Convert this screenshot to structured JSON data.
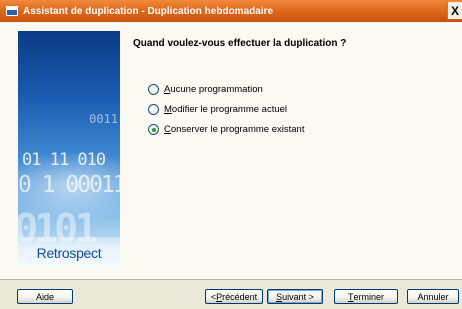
{
  "window": {
    "title": "Assistant de duplication - Duplication hebdomadaire",
    "close_label": "X"
  },
  "side_panel": {
    "brand": "Retrospect",
    "decor_digits": [
      "0011",
      "01 11 010",
      "0 1 00011",
      "0101"
    ]
  },
  "main": {
    "question": "Quand voulez-vous effectuer la duplication ?",
    "options": [
      {
        "accel": "A",
        "rest": "ucune programmation",
        "selected": false
      },
      {
        "accel": "M",
        "rest": "odifier le programme actuel",
        "selected": false
      },
      {
        "accel": "C",
        "rest": "onserver le programme existant",
        "selected": true
      }
    ]
  },
  "buttons": {
    "help": "Aide",
    "previous_prefix": "< ",
    "previous_accel": "P",
    "previous_rest": "récédent",
    "next_accel": "S",
    "next_rest": "uivant >",
    "finish_accel": "T",
    "finish_rest": "erminer",
    "cancel": "Annuler"
  },
  "colors": {
    "titlebar": "#e06a1c",
    "brand": "#0f4da0",
    "radio_dot": "#21a121"
  }
}
